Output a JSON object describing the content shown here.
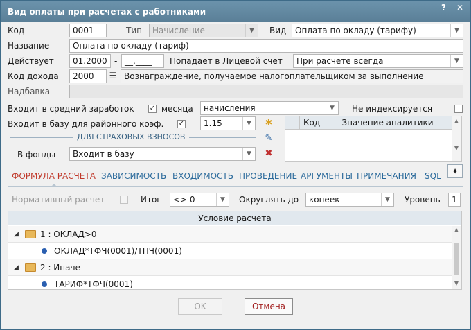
{
  "window": {
    "title": "Вид оплаты при расчетах с работниками",
    "help_label": "?",
    "close_label": "✕"
  },
  "form": {
    "kod_label": "Код",
    "kod_value": "0001",
    "tip_label": "Тип",
    "tip_value": "Начисление",
    "vid_label": "Вид",
    "vid_value": "Оплата по окладу (тарифу)",
    "name_label": "Название",
    "name_value": "Оплата по окладу (тариф)",
    "deystvuet_label": "Действует",
    "date_from": "01.2000",
    "date_sep": "-",
    "date_to": "__.____",
    "licevoy_label": "Попадает в Лицевой счет",
    "licevoy_value": "При расчете всегда",
    "kod_dohoda_label": "Код дохода",
    "kod_dohoda_value": "2000",
    "kod_dohoda_desc": "Вознаграждение, получаемое налогоплательщиком за выполнение",
    "nadbavka_label": "Надбавка",
    "nadbavka_value": "",
    "sredniy_label": "Входит в средний заработок",
    "sredniy_checked": "✓",
    "mesyaca_label": "месяца",
    "mesyaca_value": "начисления",
    "neindeks_label": "Не индексируется",
    "neindeks_checked": "",
    "rayon_label": "Входит в базу для районного коэф.",
    "rayon_checked": "✓",
    "rayon_value": "1.15",
    "strah_section": "ДЛЯ СТРАХОВЫХ ВЗНОСОВ",
    "fondy_label": "В фонды",
    "fondy_value": "Входит в базу"
  },
  "analytics_grid": {
    "col_kod": "Код",
    "col_value": "Значение аналитики"
  },
  "tabs": [
    {
      "label": "ФОРМУЛА РАСЧЕТА"
    },
    {
      "label": "ЗАВИСИМОСТЬ"
    },
    {
      "label": "ВХОДИМОСТЬ"
    },
    {
      "label": "ПРОВЕДЕНИЕ"
    },
    {
      "label": "АРГУМЕНТЫ"
    },
    {
      "label": "ПРИМЕЧАНИЯ"
    },
    {
      "label": "SQL"
    }
  ],
  "formula": {
    "normativ_label": "Нормативный расчет",
    "itog_label": "Итог",
    "itog_value": "<> 0",
    "okrugl_label": "Округлять до",
    "okrugl_value": "копеек",
    "uroven_label": "Уровень",
    "uroven_value": "1",
    "grid_header": "Условие расчета",
    "rows": [
      {
        "text": "1 : ОКЛАД>0"
      },
      {
        "text": "ОКЛАД*ТФЧ(0001)/ТПЧ(0001)"
      },
      {
        "text": "2 : Иначе"
      },
      {
        "text": "ТАРИФ*ТФЧ(0001)"
      }
    ]
  },
  "buttons": {
    "ok": "OK",
    "cancel": "Отмена"
  },
  "colors": {
    "title_bar": "#5f84a0",
    "active_tab": "#c0392b",
    "tab": "#2b6a9b",
    "cancel_text": "#a32020"
  }
}
